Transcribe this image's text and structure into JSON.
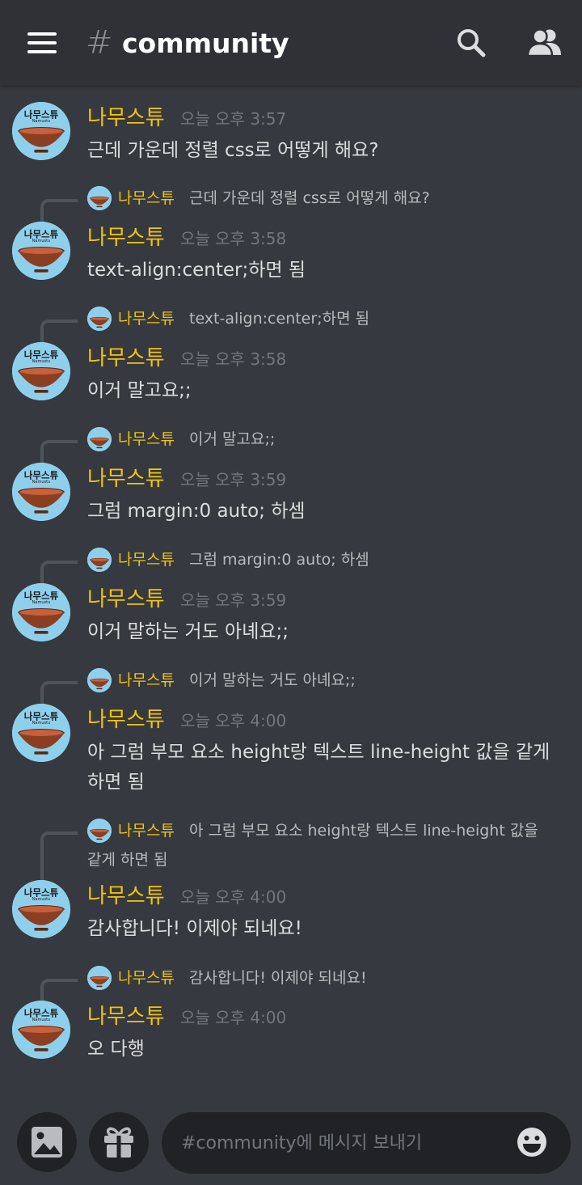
{
  "header": {
    "hash": "#",
    "channel": "community"
  },
  "avatar": {
    "line1": "나무스튜",
    "line2": "Namustu",
    "colors": {
      "bg": "#8ed0ec",
      "bowl": "#8a3f22",
      "soup": "#c9603b",
      "rim": "#5a2a17"
    }
  },
  "messages": [
    {
      "author": "나무스튜",
      "time": "오늘 오후 3:57",
      "text": "근데 가운데 정렬 css로 어떻게 해요?"
    },
    {
      "reply": {
        "author": "나무스튜",
        "text": "근데 가운데 정렬 css로 어떻게 해요?"
      },
      "author": "나무스튜",
      "time": "오늘 오후 3:58",
      "text": "text-align:center;하면 됨"
    },
    {
      "reply": {
        "author": "나무스튜",
        "text": "text-align:center;하면 됨"
      },
      "author": "나무스튜",
      "time": "오늘 오후 3:58",
      "text": "이거 말고요;;"
    },
    {
      "reply": {
        "author": "나무스튜",
        "text": "이거 말고요;;"
      },
      "author": "나무스튜",
      "time": "오늘 오후 3:59",
      "text": "그럼 margin:0 auto; 하셈"
    },
    {
      "reply": {
        "author": "나무스튜",
        "text": "그럼 margin:0 auto; 하셈"
      },
      "author": "나무스튜",
      "time": "오늘 오후 3:59",
      "text": "이거 말하는 거도 아녜요;;"
    },
    {
      "reply": {
        "author": "나무스튜",
        "text": "이거 말하는 거도 아녜요;;"
      },
      "author": "나무스튜",
      "time": "오늘 오후 4:00",
      "text": "아 그럼 부모 요소 height랑 텍스트 line-height 값을 같게 하면 됨"
    },
    {
      "reply": {
        "author": "나무스튜",
        "text_line1": "아 그럼 부모 요소 height랑 텍스트 line-height 값을",
        "text_line2": "같게 하면 됨"
      },
      "author": "나무스튜",
      "time": "오늘 오후 4:00",
      "text": "감사합니다! 이제야 되네요!"
    },
    {
      "reply": {
        "author": "나무스튜",
        "text": "감사합니다! 이제야 되네요!"
      },
      "author": "나무스튜",
      "time": "오늘 오후 4:00",
      "text": "오 다행"
    }
  ],
  "composer": {
    "placeholder": "#community에 메시지 보내기"
  },
  "colors": {
    "background": "#36393f",
    "header": "#2f3136",
    "author": "#f1c40f",
    "timestamp": "#72767d",
    "text": "#dcddde",
    "input": "#202225"
  },
  "icons": {
    "menu": "hamburger-menu-icon",
    "search": "search-icon",
    "members": "members-icon",
    "image": "image-icon",
    "gift": "gift-icon",
    "emoji": "emoji-icon"
  }
}
